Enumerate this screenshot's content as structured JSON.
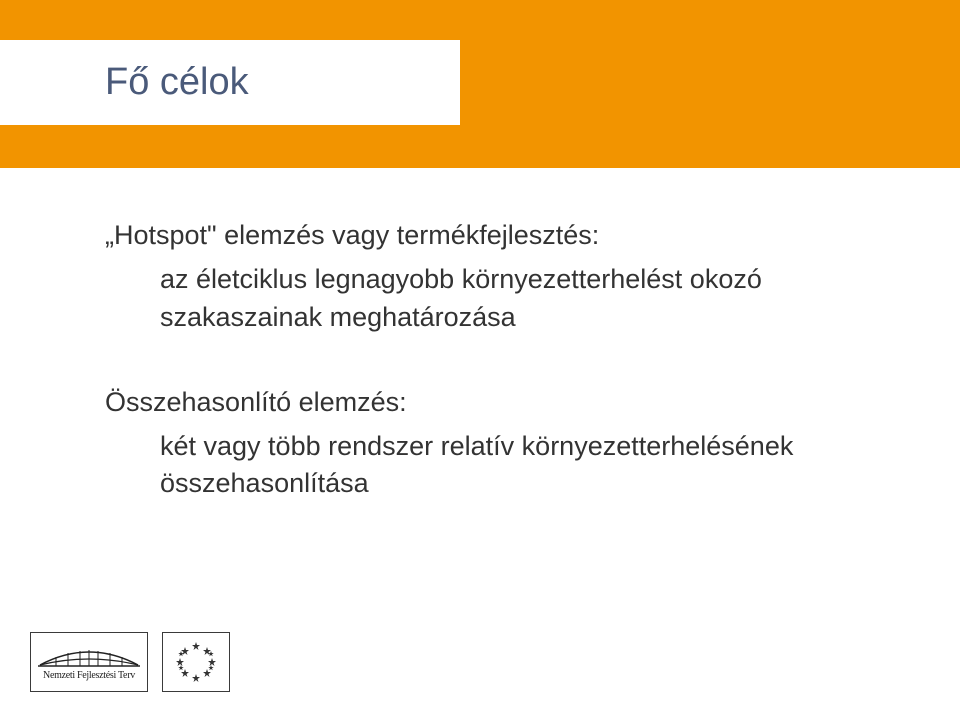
{
  "title": "Fő célok",
  "content": {
    "para1_title": "„Hotspot\" elemzés vagy termékfejlesztés:",
    "para1_line1": "az életciklus legnagyobb környezetterhelést okozó szakaszainak meghatározása",
    "para2_title": "Összehasonlító elemzés:",
    "para2_line1": "két vagy több rendszer relatív környezetterhelésének összehasonlítása"
  },
  "footer": {
    "nft_label": "Nemzeti Fejlesztési Terv",
    "eu_label": "EU"
  }
}
